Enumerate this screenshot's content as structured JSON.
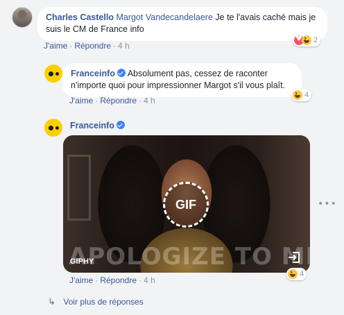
{
  "comments": [
    {
      "author": "Charles Castello",
      "mention": "Margot Vandecandelaere",
      "text": "Je te l'avais caché mais je suis le CM de France info",
      "actions": {
        "like": "J'aime",
        "reply": "Répondre",
        "time": "4 h"
      },
      "reactions": {
        "count": "2",
        "icons": [
          "love-icon",
          "haha-icon"
        ]
      }
    },
    {
      "author": "Franceinfo",
      "verified": true,
      "text": "Absolument pas, cessez de raconter n'importe quoi pour impressionner Margot s'il vous plaît.",
      "actions": {
        "like": "J'aime",
        "reply": "Répondre",
        "time": "4 h"
      },
      "reactions": {
        "count": "4",
        "icons": [
          "haha-icon"
        ]
      }
    },
    {
      "author": "Franceinfo",
      "verified": true,
      "gif": {
        "badge": "GIF",
        "caption": "APOLOGIZE TO ME",
        "source": "GIPHY"
      },
      "actions": {
        "like": "J'aime",
        "reply": "Répondre",
        "time": "4 h"
      },
      "reactions": {
        "count": "4",
        "icons": [
          "haha-icon"
        ]
      }
    }
  ],
  "more_replies": "Voir plus de réponses",
  "colors": {
    "link": "#385898",
    "meta": "#90949c",
    "background": "#f2f3f5",
    "brand_yellow": "#fbd000"
  }
}
